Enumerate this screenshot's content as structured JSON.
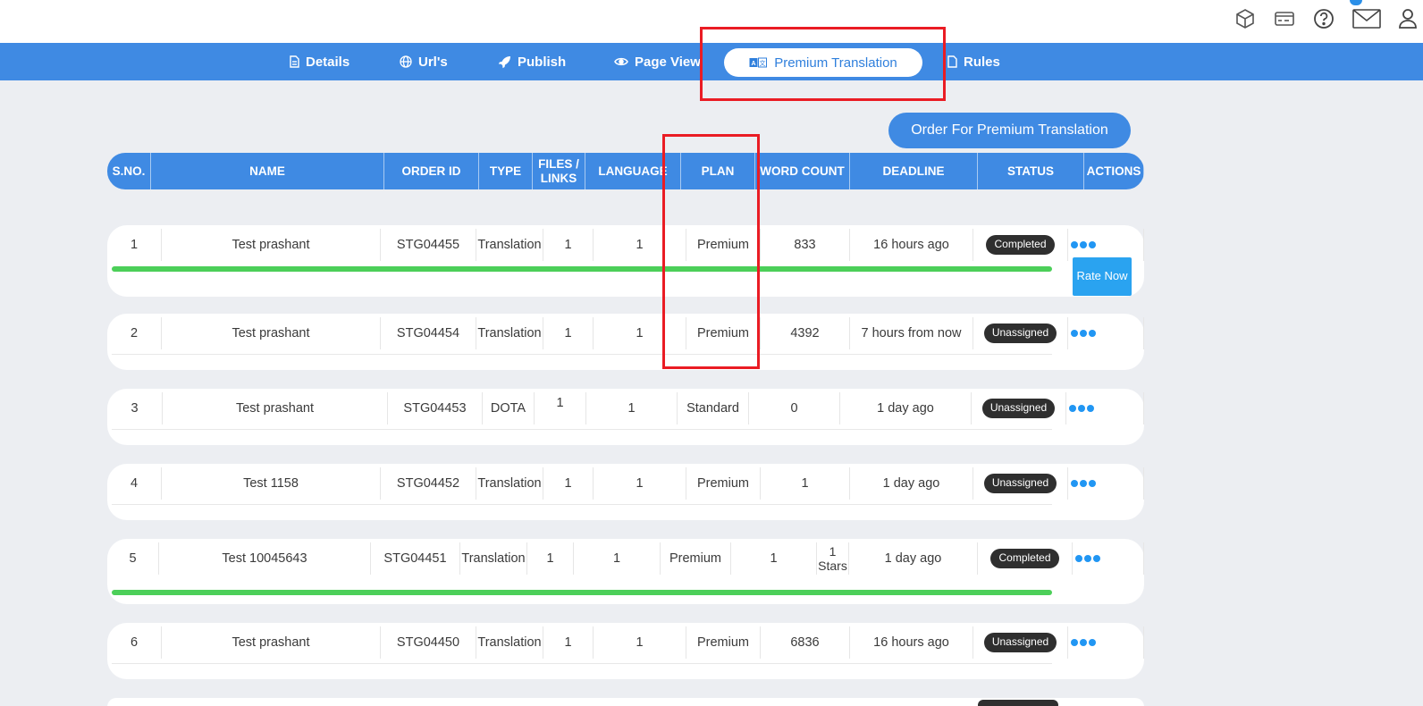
{
  "top_icons": [
    "cube-icon",
    "card-icon",
    "help-icon",
    "mail-icon",
    "user-icon"
  ],
  "nav": {
    "details": "Details",
    "urls": "Url's",
    "publish": "Publish",
    "page_view": "Page View",
    "premium_translation": "Premium Translation",
    "rules": "Rules"
  },
  "order_button": "Order For Premium Translation",
  "table": {
    "headers": [
      "S.NO.",
      "NAME",
      "ORDER ID",
      "TYPE",
      "FILES / LINKS",
      "LANGUAGE",
      "PLAN",
      "WORD COUNT",
      "DEADLINE",
      "STATUS",
      "ACTIONS"
    ],
    "rows": [
      {
        "sno": "1",
        "name": "Test prashant",
        "order_id": "STG04455",
        "type": "Translation",
        "files": "1",
        "language": "1",
        "plan": "Premium",
        "word_count": "833",
        "deadline": "16 hours ago",
        "status": "Completed",
        "rate": "Rate Now"
      },
      {
        "sno": "2",
        "name": "Test prashant",
        "order_id": "STG04454",
        "type": "Translation",
        "files": "1",
        "language": "1",
        "plan": "Premium",
        "word_count": "4392",
        "deadline": "7 hours from now",
        "status": "Unassigned"
      },
      {
        "sno": "3",
        "name": "Test prashant",
        "order_id": "STG04453",
        "type": "DOTA",
        "files": "1",
        "language": "1",
        "plan": "Standard",
        "word_count": "0",
        "deadline": "1 day ago",
        "status": "Unassigned"
      },
      {
        "sno": "4",
        "name": "Test 1158",
        "order_id": "STG04452",
        "type": "Translation",
        "files": "1",
        "language": "1",
        "plan": "Premium",
        "word_count": "1",
        "deadline": "1 day ago",
        "status": "Unassigned"
      },
      {
        "sno": "5",
        "name": "Test 10045643",
        "order_id": "STG04451",
        "type": "Translation",
        "files": "1",
        "language": "1",
        "plan": "Premium",
        "word_count": "1",
        "rating": "1 Stars",
        "deadline": "1 day ago",
        "status": "Completed"
      },
      {
        "sno": "6",
        "name": "Test prashant",
        "order_id": "STG04450",
        "type": "Translation",
        "files": "1",
        "language": "1",
        "plan": "Premium",
        "word_count": "6836",
        "deadline": "16 hours ago",
        "status": "Unassigned"
      }
    ]
  }
}
